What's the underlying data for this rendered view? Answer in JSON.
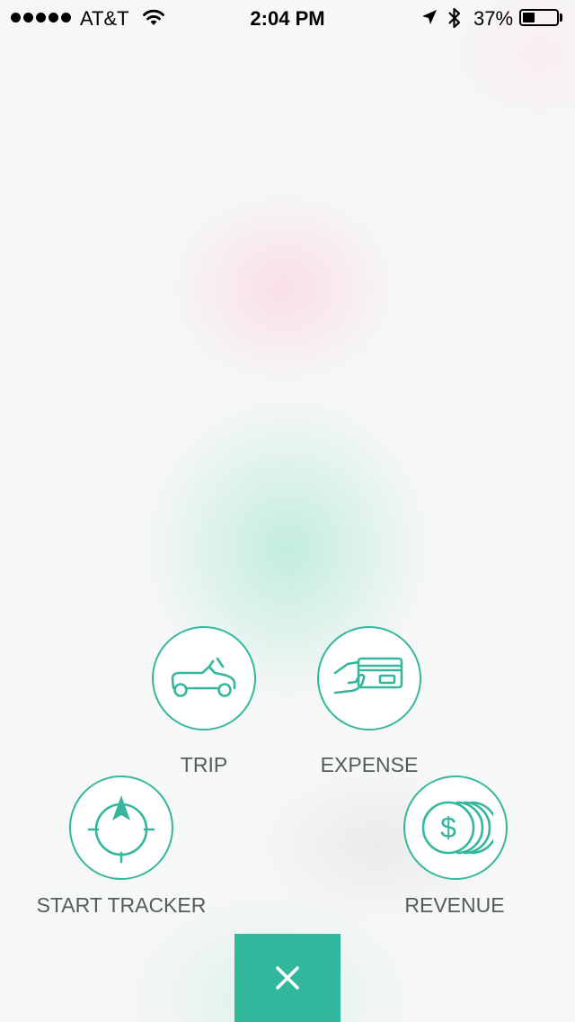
{
  "status_bar": {
    "carrier": "AT&T",
    "time": "2:04 PM",
    "battery_percent": "37%",
    "battery_level": 0.37,
    "signal_bars": 5,
    "icons": [
      "signal-dots-icon",
      "wifi-icon",
      "location-arrow-icon",
      "bluetooth-icon",
      "battery-icon"
    ]
  },
  "actions": {
    "trip": {
      "label": "TRIP",
      "icon": "car-icon"
    },
    "expense": {
      "label": "EXPENSE",
      "icon": "credit-card-icon"
    },
    "start_tracker": {
      "label": "START TRACKER",
      "icon": "compass-target-icon"
    },
    "revenue": {
      "label": "REVENUE",
      "icon": "coins-icon"
    }
  },
  "close": {
    "icon": "close-icon",
    "symbol": "×"
  },
  "colors": {
    "accent": "#31b79c",
    "label": "#555b5e",
    "background": "#f6f7f7"
  }
}
